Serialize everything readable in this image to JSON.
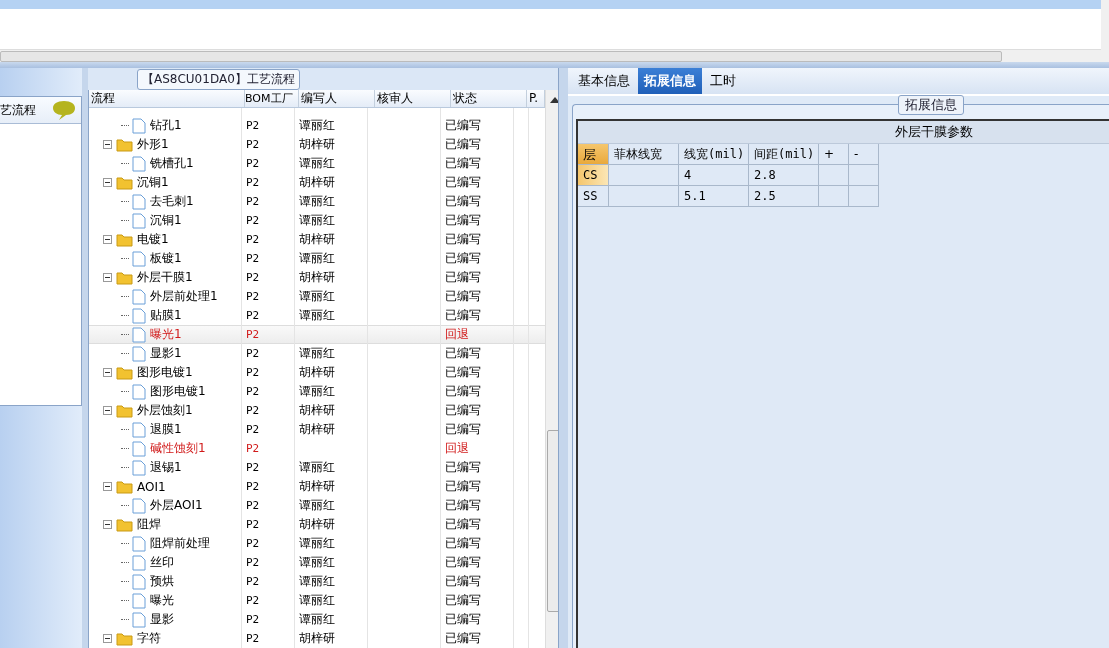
{
  "left_panel": {
    "title": "艺流程"
  },
  "flow_group": {
    "title": "【AS8CU01DA0】工艺流程"
  },
  "tree": {
    "columns": [
      "流程",
      "BOM工厂",
      "编写人",
      "核审人",
      "状态",
      "P."
    ],
    "rows": [
      {
        "kind": "group",
        "selected": false,
        "children": [
          {
            "kind": "step",
            "label": "钻孔1",
            "factory": "P2",
            "writer": "谭丽红",
            "status": "已编写",
            "selected": false,
            "rejected": false
          }
        ]
      },
      {
        "kind": "group",
        "label": "外形1",
        "factory": "P2",
        "writer": "胡梓研",
        "status": "已编写",
        "selected": false,
        "rejected": false,
        "children": [
          {
            "kind": "step",
            "label": "铣槽孔1",
            "factory": "P2",
            "writer": "谭丽红",
            "status": "已编写",
            "selected": false,
            "rejected": false
          }
        ]
      },
      {
        "kind": "group",
        "label": "沉铜1",
        "factory": "P2",
        "writer": "胡梓研",
        "status": "已编写",
        "selected": false,
        "rejected": false,
        "children": [
          {
            "kind": "step",
            "label": "去毛刺1",
            "factory": "P2",
            "writer": "谭丽红",
            "status": "已编写",
            "selected": false,
            "rejected": false
          },
          {
            "kind": "step",
            "label": "沉铜1",
            "factory": "P2",
            "writer": "谭丽红",
            "status": "已编写",
            "selected": false,
            "rejected": false
          }
        ]
      },
      {
        "kind": "group",
        "label": "电镀1",
        "factory": "P2",
        "writer": "胡梓研",
        "status": "已编写",
        "selected": false,
        "rejected": false,
        "children": [
          {
            "kind": "step",
            "label": "板镀1",
            "factory": "P2",
            "writer": "谭丽红",
            "status": "已编写",
            "selected": false,
            "rejected": false
          }
        ]
      },
      {
        "kind": "group",
        "label": "外层干膜1",
        "factory": "P2",
        "writer": "胡梓研",
        "status": "已编写",
        "selected": false,
        "rejected": false,
        "children": [
          {
            "kind": "step",
            "label": "外层前处理1",
            "factory": "P2",
            "writer": "谭丽红",
            "status": "已编写",
            "selected": false,
            "rejected": false
          },
          {
            "kind": "step",
            "label": "贴膜1",
            "factory": "P2",
            "writer": "谭丽红",
            "status": "已编写",
            "selected": false,
            "rejected": false
          },
          {
            "kind": "step",
            "label": "曝光1",
            "factory": "P2",
            "status": "回退",
            "selected": true,
            "rejected": true
          },
          {
            "kind": "step",
            "label": "显影1",
            "factory": "P2",
            "writer": "谭丽红",
            "status": "已编写",
            "selected": false,
            "rejected": false
          }
        ]
      },
      {
        "kind": "group",
        "label": "图形电镀1",
        "factory": "P2",
        "writer": "胡梓研",
        "status": "已编写",
        "selected": false,
        "rejected": false,
        "children": [
          {
            "kind": "step",
            "label": "图形电镀1",
            "factory": "P2",
            "writer": "谭丽红",
            "status": "已编写",
            "selected": false,
            "rejected": false
          }
        ]
      },
      {
        "kind": "group",
        "label": "外层蚀刻1",
        "factory": "P2",
        "writer": "胡梓研",
        "status": "已编写",
        "selected": false,
        "rejected": false,
        "children": [
          {
            "kind": "step",
            "label": "退膜1",
            "factory": "P2",
            "writer": "胡梓研",
            "status": "已编写",
            "selected": false,
            "rejected": false
          },
          {
            "kind": "step",
            "label": "碱性蚀刻1",
            "factory": "P2",
            "status": "回退",
            "selected": false,
            "rejected": true
          },
          {
            "kind": "step",
            "label": "退锡1",
            "factory": "P2",
            "writer": "谭丽红",
            "status": "已编写",
            "selected": false,
            "rejected": false
          }
        ]
      },
      {
        "kind": "group",
        "label": "AOI1",
        "factory": "P2",
        "writer": "胡梓研",
        "status": "已编写",
        "selected": false,
        "rejected": false,
        "children": [
          {
            "kind": "step",
            "label": "外层AOI1",
            "factory": "P2",
            "writer": "谭丽红",
            "status": "已编写",
            "selected": false,
            "rejected": false
          }
        ]
      },
      {
        "kind": "group",
        "label": "阻焊",
        "factory": "P2",
        "writer": "胡梓研",
        "status": "已编写",
        "selected": false,
        "rejected": false,
        "children": [
          {
            "kind": "step",
            "label": "阻焊前处理",
            "factory": "P2",
            "writer": "谭丽红",
            "status": "已编写",
            "selected": false,
            "rejected": false
          },
          {
            "kind": "step",
            "label": "丝印",
            "factory": "P2",
            "writer": "谭丽红",
            "status": "已编写",
            "selected": false,
            "rejected": false
          },
          {
            "kind": "step",
            "label": "预烘",
            "factory": "P2",
            "writer": "谭丽红",
            "status": "已编写",
            "selected": false,
            "rejected": false
          },
          {
            "kind": "step",
            "label": "曝光",
            "factory": "P2",
            "writer": "谭丽红",
            "status": "已编写",
            "selected": false,
            "rejected": false
          },
          {
            "kind": "step",
            "label": "显影",
            "factory": "P2",
            "writer": "谭丽红",
            "status": "已编写",
            "selected": false,
            "rejected": false
          }
        ]
      },
      {
        "kind": "group",
        "label": "字符",
        "factory": "P2",
        "writer": "胡梓研",
        "status": "已编写",
        "selected": false,
        "rejected": false,
        "children": []
      }
    ]
  },
  "tabs": [
    {
      "label": "基本信息",
      "selected": false
    },
    {
      "label": "拓展信息",
      "selected": true
    },
    {
      "label": "工时",
      "selected": false
    }
  ],
  "ext_group": {
    "title": "拓展信息",
    "table": {
      "title": "外层干膜参数",
      "columns": [
        "层",
        "菲林线宽",
        "线宽(mil)",
        "间距(mil)",
        "+",
        "-"
      ],
      "rows": [
        {
          "cells": [
            "CS",
            "",
            "4",
            "2.8",
            "",
            ""
          ],
          "selected": true
        },
        {
          "cells": [
            "SS",
            "",
            "5.1",
            "2.5",
            "",
            ""
          ],
          "selected": false
        }
      ]
    }
  }
}
